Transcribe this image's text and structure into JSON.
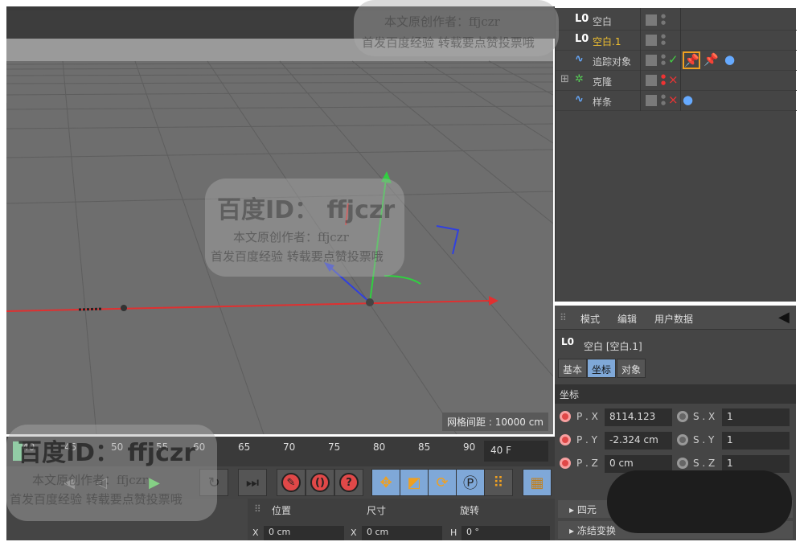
{
  "viewport": {
    "grid_spacing": "网格间距 : 10000 cm"
  },
  "timeline": {
    "ticks": [
      "40",
      "45",
      "50",
      "55",
      "60",
      "65",
      "70",
      "75",
      "80",
      "85",
      "90"
    ],
    "current_frame": "40 F"
  },
  "transport": {
    "icons": [
      "prev-key-icon",
      "play-backward-icon",
      "play-icon",
      "next-frame-icon",
      "loop-icon",
      "goto-end-icon",
      "record-keys-icon",
      "auto-key-icon",
      "key-help-icon",
      "move-key-icon",
      "scale-key-icon",
      "rotate-key-icon",
      "param-key-icon",
      "point-level-icon",
      "timeline-icon"
    ]
  },
  "coord_manager": {
    "headers": [
      "位置",
      "尺寸",
      "旋转"
    ],
    "x_pos": "0 cm",
    "x_size": "0 cm",
    "h_rot": "0 °",
    "labels": [
      "X",
      "X",
      "H"
    ]
  },
  "object_manager": {
    "objects": [
      {
        "name": "空白",
        "icon": "L0",
        "selected": false
      },
      {
        "name": "空白.1",
        "icon": "L0",
        "selected": true
      },
      {
        "name": "追踪对象",
        "icon": "spline",
        "check": "✓"
      },
      {
        "name": "克隆",
        "icon": "cloner",
        "x": "×"
      },
      {
        "name": "样条",
        "icon": "spline",
        "x": "×"
      }
    ]
  },
  "attribute_manager": {
    "menu": [
      "模式",
      "编辑",
      "用户数据"
    ],
    "title_icon": "L0",
    "title": "空白 [空白.1]",
    "tabs": [
      "基本",
      "坐标",
      "对象"
    ],
    "section": "坐标",
    "rows": [
      {
        "label": "P . X",
        "value": "8114.123",
        "s_label": "S . X",
        "s_value": "1"
      },
      {
        "label": "P . Y",
        "value": "-2.324 cm",
        "s_label": "S . Y",
        "s_value": "1"
      },
      {
        "label": "P . Z",
        "value": "0 cm",
        "s_label": "S . Z",
        "s_value": "1"
      }
    ],
    "folds": [
      "四元",
      "冻结变换"
    ]
  },
  "watermark": {
    "id": "百度ID： ffjczr",
    "author": "本文原创作者：ffjczr",
    "note": "首发百度经验  转载要点赞投票哦"
  },
  "colors": {
    "accent": "#7fa8d8",
    "selected_name": "#f0c030",
    "axis_x": "#e03030",
    "axis_y": "#30d040",
    "axis_z": "#3040e0"
  }
}
